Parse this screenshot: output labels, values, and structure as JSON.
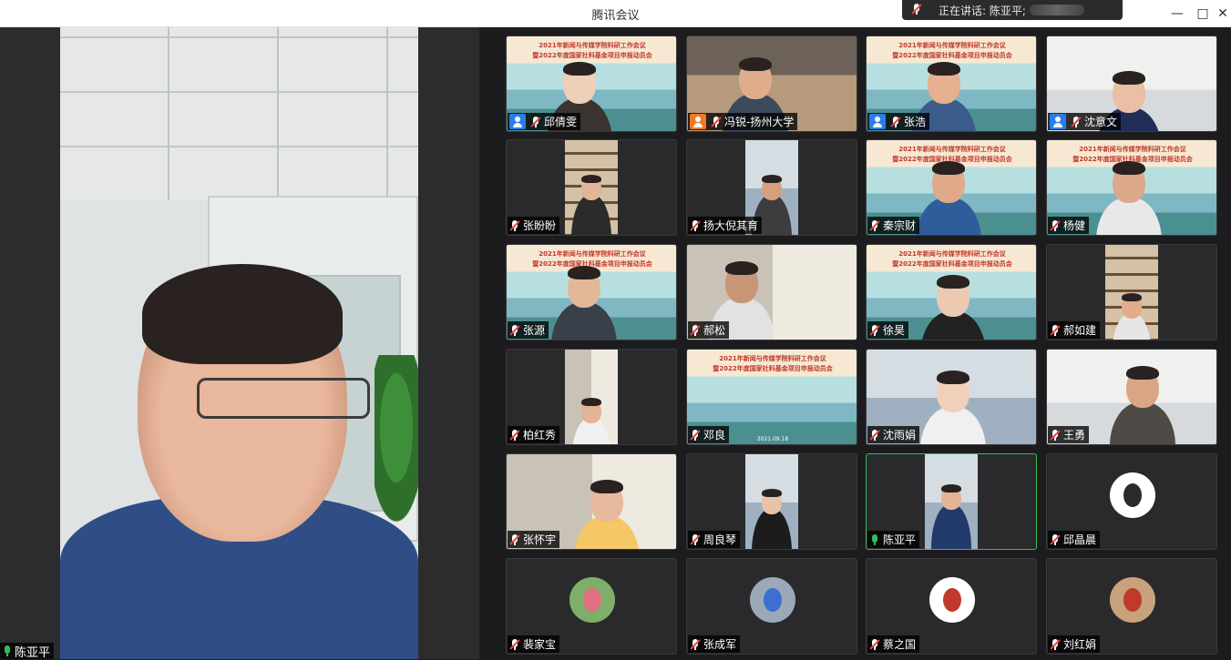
{
  "window": {
    "title": "腾讯会议",
    "speaking_label": "正在讲话: 陈亚平;",
    "controls": [
      "—",
      "□",
      "✕"
    ]
  },
  "main_video": {
    "name": "陈亚平"
  },
  "tiles": [
    {
      "name": "邱倩雯"
    },
    {
      "name": "冯锐-扬州大学"
    },
    {
      "name": "张浩"
    },
    {
      "name": "沈意文"
    },
    {
      "name": "张盼盼"
    },
    {
      "name": "扬大倪其育"
    },
    {
      "name": "秦宗财"
    },
    {
      "name": "杨健"
    },
    {
      "name": "张源"
    },
    {
      "name": "郝松"
    },
    {
      "name": "徐昊"
    },
    {
      "name": "郝如建"
    },
    {
      "name": "柏红秀"
    },
    {
      "name": "邓良"
    },
    {
      "name": "沈雨娟"
    },
    {
      "name": "王勇"
    },
    {
      "name": "张怀宇"
    },
    {
      "name": "周良琴"
    },
    {
      "name": "陈亚平"
    },
    {
      "name": "邱晶晨"
    },
    {
      "name": "裴家宝"
    },
    {
      "name": "张成军"
    },
    {
      "name": "蔡之国"
    },
    {
      "name": "刘红娟"
    }
  ],
  "banner": {
    "line1": "2021年新闻与传媒学院科研工作会议",
    "line2": "暨2022年度国家社科基金项目申报动员会",
    "date": "2021.09.18"
  },
  "colors": {
    "active_border": "#2fbf58",
    "muted_red": "#e84343",
    "user_blue": "#2b7de9",
    "user_orange": "#f07a22"
  }
}
